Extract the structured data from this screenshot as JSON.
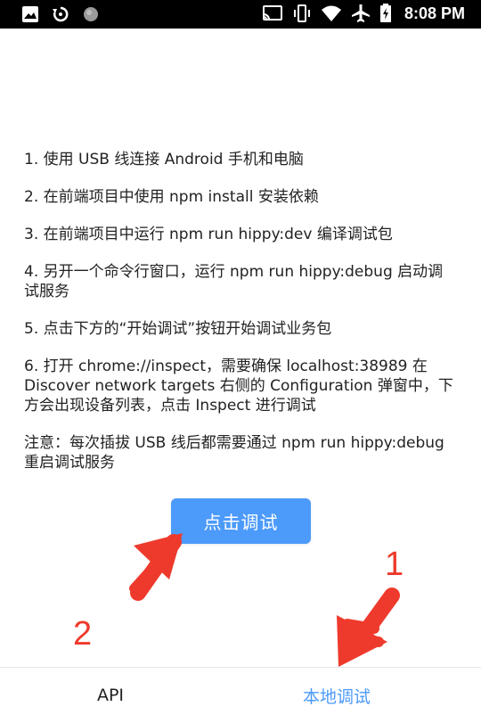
{
  "statusbar": {
    "time": "8:08 PM",
    "left_icons": [
      "image-icon",
      "sync-icon",
      "circle-icon"
    ],
    "right_icons": [
      "cast-icon",
      "vibrate-icon",
      "wifi-icon",
      "airplane-icon",
      "battery-icon"
    ]
  },
  "instructions": [
    "1. 使用 USB 线连接 Android 手机和电脑",
    "2. 在前端项目中使用 npm install 安装依赖",
    "3. 在前端项目中运行 npm run hippy:dev 编译调试包",
    "4. 另开一个命令行窗口，运行 npm run hippy:debug 启动调试服务",
    "5. 点击下方的“开始调试”按钮开始调试业务包",
    "6. 打开 chrome://inspect，需要确保 localhost:38989 在 Discover network targets 右侧的 Configuration 弹窗中，下方会出现设备列表，点击 Inspect 进行调试",
    "注意：每次插拔 USB 线后都需要通过 npm run hippy:debug 重启调试服务"
  ],
  "button": {
    "label": "点击调试"
  },
  "annotations": {
    "one": "1",
    "two": "2"
  },
  "tabs": [
    {
      "label": "API",
      "active": false
    },
    {
      "label": "本地调试",
      "active": true
    }
  ],
  "colors": {
    "accent": "#4c9afa",
    "annotation": "#ee3a2c"
  }
}
